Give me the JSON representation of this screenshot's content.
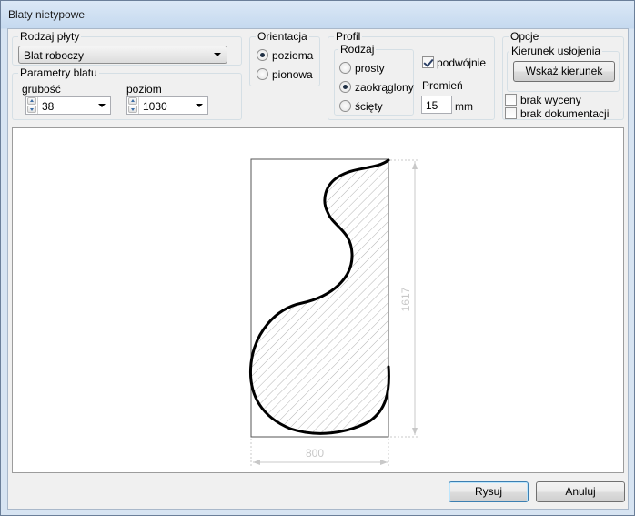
{
  "window": {
    "title": "Blaty nietypowe"
  },
  "board_type": {
    "legend": "Rodzaj płyty",
    "selected": "Blat roboczy"
  },
  "worktop_params": {
    "legend": "Parametry blatu",
    "thickness": {
      "label": "grubość",
      "value": "38"
    },
    "level": {
      "label": "poziom",
      "value": "1030"
    }
  },
  "orientation": {
    "legend": "Orientacja",
    "options": [
      {
        "label": "pozioma",
        "selected": true
      },
      {
        "label": "pionowa",
        "selected": false
      }
    ]
  },
  "profile": {
    "legend": "Profil",
    "type": {
      "legend": "Rodzaj",
      "options": [
        {
          "label": "prosty",
          "selected": false
        },
        {
          "label": "zaokrąglony",
          "selected": true
        },
        {
          "label": "ścięty",
          "selected": false
        }
      ]
    },
    "double": {
      "label": "podwójnie",
      "checked": true
    },
    "radius": {
      "label": "Promień",
      "value": "15",
      "unit": "mm"
    }
  },
  "options": {
    "legend": "Opcje",
    "direction": {
      "legend": "Kierunek usłojenia",
      "button_label": "Wskaż kierunek"
    },
    "no_pricing": {
      "label": "brak wyceny",
      "checked": false
    },
    "no_docs": {
      "label": "brak dokumentacji",
      "checked": false
    }
  },
  "drawing": {
    "width_label": "800",
    "height_label": "1617"
  },
  "buttons": {
    "draw": "Rysuj",
    "cancel": "Anuluj"
  },
  "colors": {
    "shape_stroke": "#000000",
    "hatch": "#b4b4b4",
    "dimension": "#c8c8c8"
  }
}
